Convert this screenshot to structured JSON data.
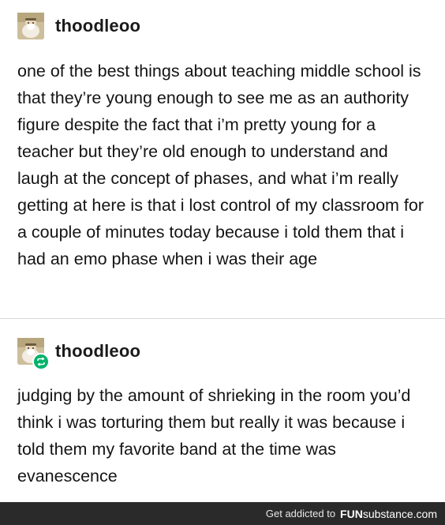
{
  "posts": [
    {
      "username": "thoodleoo",
      "avatar_icon": "user-avatar-icon",
      "body": "one of the best things about teaching middle school is that they’re young enough to see me as an authority figure despite the fact that i’m pretty young for a teacher but they’re old enough to understand and laugh at the concept of phases, and what i’m really getting at here is that i lost control of my classroom for a couple of minutes today because i told them that i had an emo phase when i was their age"
    },
    {
      "username": "thoodleoo",
      "avatar_icon": "user-avatar-icon",
      "badge_icon": "reblog-icon",
      "body": "judging by the amount of shrieking in the room you’d think i was torturing them but really it was because i told them my favorite band at the time was evanescence"
    }
  ],
  "footer": {
    "prefix": "Get addicted to",
    "brand_bold": "FUN",
    "brand_rest": "substance.com"
  },
  "colors": {
    "reblog_badge": "#00b26b",
    "footer_bg": "#2a2a2a"
  }
}
